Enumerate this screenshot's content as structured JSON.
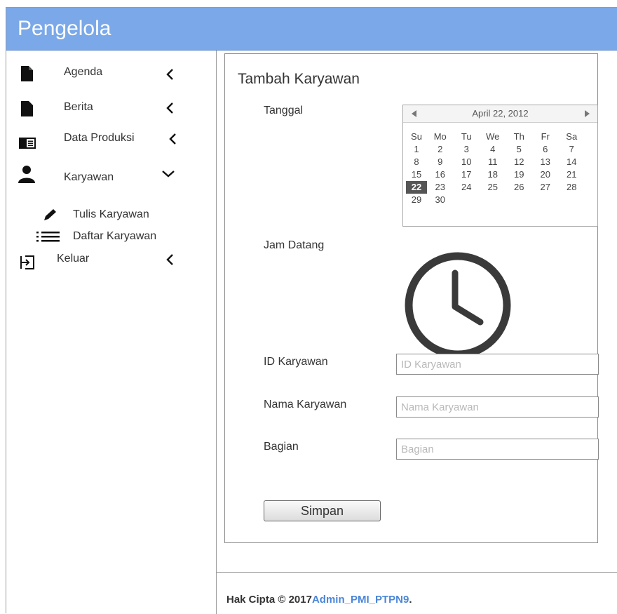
{
  "app": {
    "title": "Pengelola"
  },
  "sidebar": {
    "items": [
      {
        "label": "Agenda",
        "icon": "document-icon",
        "chevron": "chevron-left-icon"
      },
      {
        "label": "Berita",
        "icon": "document-icon",
        "chevron": "chevron-left-icon"
      },
      {
        "label": "Data Produksi",
        "icon": "book-icon",
        "chevron": "chevron-left-icon"
      },
      {
        "label": "Karyawan",
        "icon": "user-icon",
        "chevron": "chevron-down-icon",
        "expanded": true,
        "subitems": [
          {
            "label": "Tulis Karyawan",
            "icon": "pencil-icon"
          },
          {
            "label": "Daftar Karyawan",
            "icon": "list-icon"
          }
        ]
      },
      {
        "label": "Keluar",
        "icon": "sign-out-icon",
        "chevron": "chevron-left-icon"
      }
    ]
  },
  "form": {
    "title": "Tambah Karyawan",
    "tanggal_label": "Tanggal",
    "calendar": {
      "month_label": "April 22, 2012",
      "weekdays": [
        "Su",
        "Mo",
        "Tu",
        "We",
        "Th",
        "Fr",
        "Sa"
      ],
      "weeks": [
        [
          "1",
          "2",
          "3",
          "4",
          "5",
          "6",
          "7"
        ],
        [
          "8",
          "9",
          "10",
          "11",
          "12",
          "13",
          "14"
        ],
        [
          "15",
          "16",
          "17",
          "18",
          "19",
          "20",
          "21"
        ],
        [
          "22",
          "23",
          "24",
          "25",
          "26",
          "27",
          "28"
        ],
        [
          "29",
          "30",
          "",
          "",
          "",
          "",
          ""
        ]
      ],
      "selected_day": "22"
    },
    "jam_label": "Jam Datang",
    "clock_icon": "clock-icon",
    "id_label": "ID Karyawan",
    "id_placeholder": "ID Karyawan",
    "nama_label": "Nama Karyawan",
    "nama_placeholder": "Nama Karyawan",
    "bagian_label": "Bagian",
    "bagian_placeholder": "Bagian",
    "submit_label": "Simpan"
  },
  "footer": {
    "copyright": "Hak Cipta © 2017",
    "link_text": "Admin_PMI_PTPN9",
    "suffix": ".",
    "link_color": "#4a86d8"
  },
  "colors": {
    "header_bg": "#7aa8e8",
    "header_text": "#ffffff",
    "selected_day_bg": "#555555"
  }
}
